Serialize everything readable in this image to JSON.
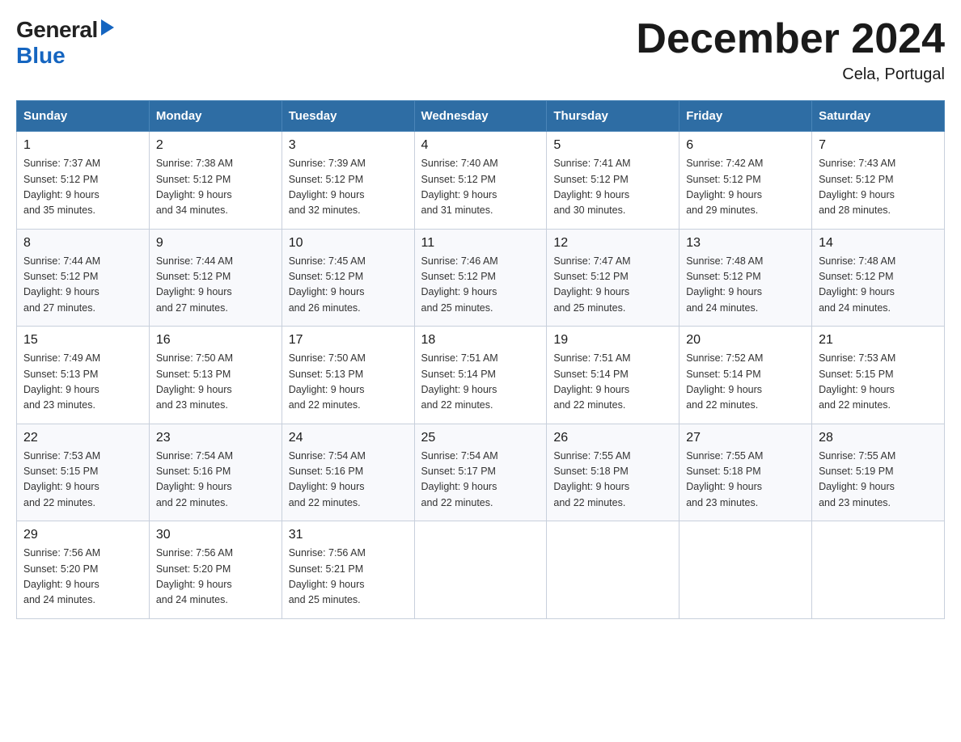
{
  "header": {
    "logo_general": "General",
    "logo_blue": "Blue",
    "month_title": "December 2024",
    "location": "Cela, Portugal"
  },
  "weekdays": [
    "Sunday",
    "Monday",
    "Tuesday",
    "Wednesday",
    "Thursday",
    "Friday",
    "Saturday"
  ],
  "weeks": [
    [
      {
        "day": "1",
        "sunrise": "7:37 AM",
        "sunset": "5:12 PM",
        "daylight": "9 hours and 35 minutes."
      },
      {
        "day": "2",
        "sunrise": "7:38 AM",
        "sunset": "5:12 PM",
        "daylight": "9 hours and 34 minutes."
      },
      {
        "day": "3",
        "sunrise": "7:39 AM",
        "sunset": "5:12 PM",
        "daylight": "9 hours and 32 minutes."
      },
      {
        "day": "4",
        "sunrise": "7:40 AM",
        "sunset": "5:12 PM",
        "daylight": "9 hours and 31 minutes."
      },
      {
        "day": "5",
        "sunrise": "7:41 AM",
        "sunset": "5:12 PM",
        "daylight": "9 hours and 30 minutes."
      },
      {
        "day": "6",
        "sunrise": "7:42 AM",
        "sunset": "5:12 PM",
        "daylight": "9 hours and 29 minutes."
      },
      {
        "day": "7",
        "sunrise": "7:43 AM",
        "sunset": "5:12 PM",
        "daylight": "9 hours and 28 minutes."
      }
    ],
    [
      {
        "day": "8",
        "sunrise": "7:44 AM",
        "sunset": "5:12 PM",
        "daylight": "9 hours and 27 minutes."
      },
      {
        "day": "9",
        "sunrise": "7:44 AM",
        "sunset": "5:12 PM",
        "daylight": "9 hours and 27 minutes."
      },
      {
        "day": "10",
        "sunrise": "7:45 AM",
        "sunset": "5:12 PM",
        "daylight": "9 hours and 26 minutes."
      },
      {
        "day": "11",
        "sunrise": "7:46 AM",
        "sunset": "5:12 PM",
        "daylight": "9 hours and 25 minutes."
      },
      {
        "day": "12",
        "sunrise": "7:47 AM",
        "sunset": "5:12 PM",
        "daylight": "9 hours and 25 minutes."
      },
      {
        "day": "13",
        "sunrise": "7:48 AM",
        "sunset": "5:12 PM",
        "daylight": "9 hours and 24 minutes."
      },
      {
        "day": "14",
        "sunrise": "7:48 AM",
        "sunset": "5:12 PM",
        "daylight": "9 hours and 24 minutes."
      }
    ],
    [
      {
        "day": "15",
        "sunrise": "7:49 AM",
        "sunset": "5:13 PM",
        "daylight": "9 hours and 23 minutes."
      },
      {
        "day": "16",
        "sunrise": "7:50 AM",
        "sunset": "5:13 PM",
        "daylight": "9 hours and 23 minutes."
      },
      {
        "day": "17",
        "sunrise": "7:50 AM",
        "sunset": "5:13 PM",
        "daylight": "9 hours and 22 minutes."
      },
      {
        "day": "18",
        "sunrise": "7:51 AM",
        "sunset": "5:14 PM",
        "daylight": "9 hours and 22 minutes."
      },
      {
        "day": "19",
        "sunrise": "7:51 AM",
        "sunset": "5:14 PM",
        "daylight": "9 hours and 22 minutes."
      },
      {
        "day": "20",
        "sunrise": "7:52 AM",
        "sunset": "5:14 PM",
        "daylight": "9 hours and 22 minutes."
      },
      {
        "day": "21",
        "sunrise": "7:53 AM",
        "sunset": "5:15 PM",
        "daylight": "9 hours and 22 minutes."
      }
    ],
    [
      {
        "day": "22",
        "sunrise": "7:53 AM",
        "sunset": "5:15 PM",
        "daylight": "9 hours and 22 minutes."
      },
      {
        "day": "23",
        "sunrise": "7:54 AM",
        "sunset": "5:16 PM",
        "daylight": "9 hours and 22 minutes."
      },
      {
        "day": "24",
        "sunrise": "7:54 AM",
        "sunset": "5:16 PM",
        "daylight": "9 hours and 22 minutes."
      },
      {
        "day": "25",
        "sunrise": "7:54 AM",
        "sunset": "5:17 PM",
        "daylight": "9 hours and 22 minutes."
      },
      {
        "day": "26",
        "sunrise": "7:55 AM",
        "sunset": "5:18 PM",
        "daylight": "9 hours and 22 minutes."
      },
      {
        "day": "27",
        "sunrise": "7:55 AM",
        "sunset": "5:18 PM",
        "daylight": "9 hours and 23 minutes."
      },
      {
        "day": "28",
        "sunrise": "7:55 AM",
        "sunset": "5:19 PM",
        "daylight": "9 hours and 23 minutes."
      }
    ],
    [
      {
        "day": "29",
        "sunrise": "7:56 AM",
        "sunset": "5:20 PM",
        "daylight": "9 hours and 24 minutes."
      },
      {
        "day": "30",
        "sunrise": "7:56 AM",
        "sunset": "5:20 PM",
        "daylight": "9 hours and 24 minutes."
      },
      {
        "day": "31",
        "sunrise": "7:56 AM",
        "sunset": "5:21 PM",
        "daylight": "9 hours and 25 minutes."
      },
      null,
      null,
      null,
      null
    ]
  ],
  "labels": {
    "sunrise": "Sunrise:",
    "sunset": "Sunset:",
    "daylight": "Daylight:"
  }
}
